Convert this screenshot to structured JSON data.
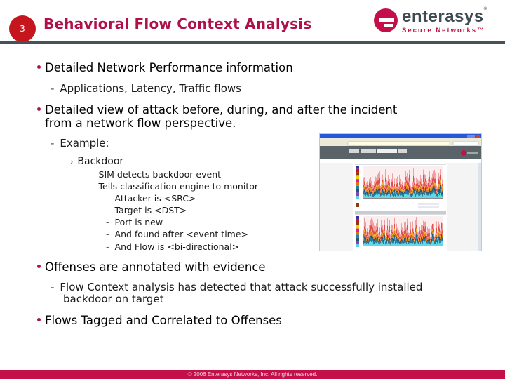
{
  "header": {
    "slide_number": "3",
    "title": "Behavioral Flow Context Analysis",
    "logo": {
      "icon": "enterasys-e-logo-icon",
      "wordmark": "enterasys",
      "registered": "®",
      "tagline": "Secure Networks™"
    }
  },
  "colors": {
    "title": "#b0104a",
    "slide_number_badge": "#c4161c",
    "header_bar": "#46525a",
    "footer": "#c4104a",
    "bullet": "#b0104a"
  },
  "content": {
    "bullets": [
      {
        "text": "Detailed Network Performance information",
        "sub": [
          {
            "text": "Applications, Latency, Traffic flows"
          }
        ]
      },
      {
        "text_lines": [
          "Detailed view of attack before, during, and after the incident",
          "from a network flow perspective."
        ],
        "sub": [
          {
            "text": "Example:",
            "sub": [
              {
                "text": "Backdoor",
                "sub": [
                  {
                    "text": "SIM detects backdoor event"
                  },
                  {
                    "text": "Tells classification engine to monitor",
                    "sub": [
                      {
                        "text": "Attacker is <SRC>"
                      },
                      {
                        "text": "Target is <DST>"
                      },
                      {
                        "text": "Port is new"
                      },
                      {
                        "text": "And found after <event time>"
                      },
                      {
                        "text": "And Flow is <bi-directional>"
                      }
                    ]
                  }
                ]
              }
            ]
          }
        ]
      },
      {
        "text": "Offenses are annotated with evidence",
        "sub": [
          {
            "text_lines": [
              "Flow Context analysis has detected that attack successfully installed",
              "backdoor on target"
            ]
          }
        ]
      },
      {
        "text": "Flows Tagged and Correlated to Offenses"
      }
    ]
  },
  "embedded_screenshot": {
    "description": "Browser window showing network flow activity stacked-bar charts",
    "chart_colors": [
      "#3a2fa0",
      "#c4161c",
      "#8b3a10",
      "#f0d000",
      "#d020a0",
      "#e07010",
      "#2080a0",
      "#2a5070",
      "#8040c0",
      "#60d0e0"
    ]
  },
  "footer": {
    "text": "© 2006 Enterasys Networks, Inc.  All rights reserved."
  }
}
